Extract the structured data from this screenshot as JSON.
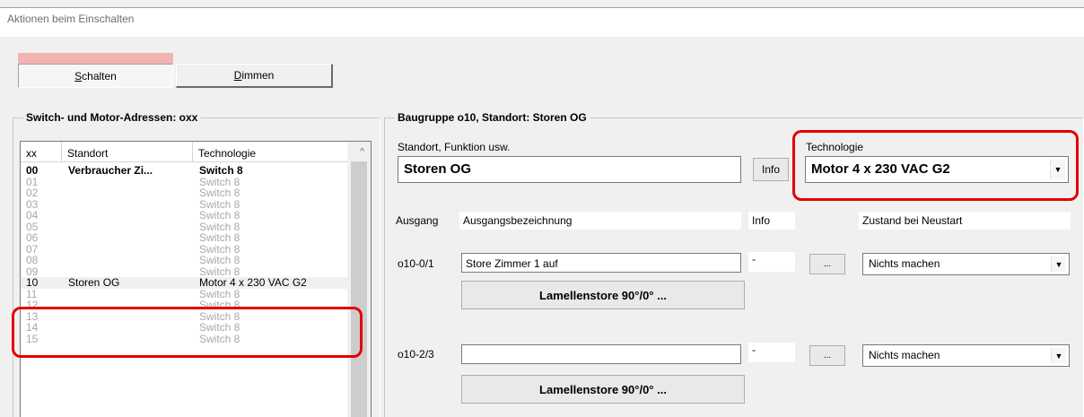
{
  "window": {
    "title": "Aktionen beim Einschalten"
  },
  "tabs": [
    {
      "label": "Schalten",
      "key": "S",
      "rest": "chalten",
      "selected": true
    },
    {
      "label": "Dimmen",
      "key": "D",
      "rest": "immen",
      "selected": false
    }
  ],
  "left_group": {
    "title": "Switch- und Motor-Adressen: oxx",
    "columns": [
      "xx",
      "Standort",
      "Technologie"
    ],
    "rows": [
      {
        "xx": "00",
        "standort": "Verbraucher Zi...",
        "tech": "Switch 8",
        "style": "bold"
      },
      {
        "xx": "01",
        "standort": "",
        "tech": "Switch 8",
        "style": "grey"
      },
      {
        "xx": "02",
        "standort": "",
        "tech": "Switch 8",
        "style": "grey"
      },
      {
        "xx": "03",
        "standort": "",
        "tech": "Switch 8",
        "style": "grey"
      },
      {
        "xx": "04",
        "standort": "",
        "tech": "Switch 8",
        "style": "grey"
      },
      {
        "xx": "05",
        "standort": "",
        "tech": "Switch 8",
        "style": "grey"
      },
      {
        "xx": "06",
        "standort": "",
        "tech": "Switch 8",
        "style": "grey"
      },
      {
        "xx": "07",
        "standort": "",
        "tech": "Switch 8",
        "style": "grey"
      },
      {
        "xx": "08",
        "standort": "",
        "tech": "Switch 8",
        "style": "grey"
      },
      {
        "xx": "09",
        "standort": "",
        "tech": "Switch 8",
        "style": "grey"
      },
      {
        "xx": "10",
        "standort": "Storen OG",
        "tech": "Motor 4 x 230 VAC G2",
        "style": "sel"
      },
      {
        "xx": "11",
        "standort": "",
        "tech": "Switch 8",
        "style": "grey"
      },
      {
        "xx": "12",
        "standort": "",
        "tech": "Switch 8",
        "style": "grey"
      },
      {
        "xx": "13",
        "standort": "",
        "tech": "Switch 8",
        "style": "grey"
      },
      {
        "xx": "14",
        "standort": "",
        "tech": "Switch 8",
        "style": "grey"
      },
      {
        "xx": "15",
        "standort": "",
        "tech": "Switch 8",
        "style": "grey"
      }
    ]
  },
  "right_group": {
    "title": "Baugruppe o10, Standort: Storen OG",
    "standort_label": "Standort, Funktion usw.",
    "standort_value": "Storen OG",
    "info_button": "Info",
    "technologie_label": "Technologie",
    "technologie_value": "Motor 4 x 230 VAC G2",
    "headers": {
      "ausgang": "Ausgang",
      "bezeichnung": "Ausgangsbezeichnung",
      "info": "Info",
      "zustand": "Zustand bei Neustart"
    },
    "outputs": [
      {
        "ausgang": "o10-0/1",
        "bezeichnung": "Store Zimmer 1 auf",
        "info": "-",
        "dots": "...",
        "zustand": "Nichts machen",
        "action": "Lamellenstore 90°/0° ..."
      },
      {
        "ausgang": "o10-2/3",
        "bezeichnung": "",
        "info": "-",
        "dots": "...",
        "zustand": "Nichts machen",
        "action": "Lamellenstore 90°/0° ..."
      }
    ]
  },
  "highlight_color": "#e30000"
}
